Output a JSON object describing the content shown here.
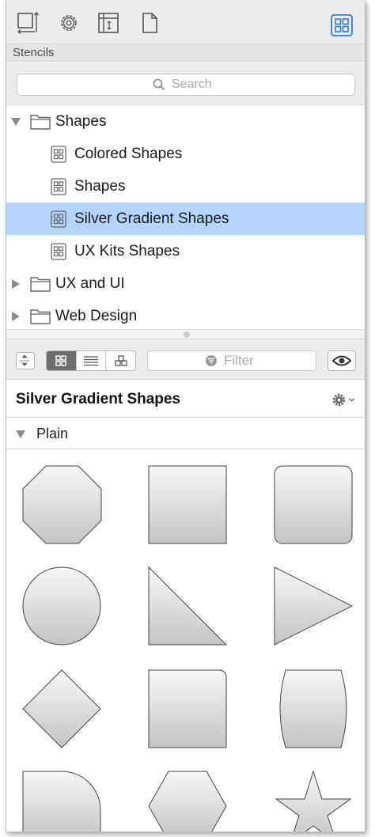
{
  "section_label": "Stencils",
  "search": {
    "placeholder": "Search"
  },
  "tree": {
    "items": [
      {
        "label": "Shapes",
        "type": "folder",
        "expanded": true
      },
      {
        "label": "Colored Shapes",
        "type": "stencil"
      },
      {
        "label": "Shapes",
        "type": "stencil"
      },
      {
        "label": "Silver Gradient Shapes",
        "type": "stencil",
        "selected": true
      },
      {
        "label": "UX Kits Shapes",
        "type": "stencil"
      },
      {
        "label": "UX and UI",
        "type": "folder",
        "expanded": false
      },
      {
        "label": "Web Design",
        "type": "folder",
        "expanded": false
      }
    ]
  },
  "filter": {
    "placeholder": "Filter"
  },
  "stencil": {
    "title": "Silver Gradient Shapes"
  },
  "group": {
    "label": "Plain"
  },
  "colors": {
    "selection": "#b4d5fb",
    "accent": "#2f7bd8",
    "shape_top": "#f7f7f7",
    "shape_bottom": "#c4c4c4"
  },
  "icons": [
    "canvas-size-icon",
    "gear-icon",
    "inspector-icon",
    "document-icon",
    "stencil-grid-icon",
    "search-icon",
    "filter-icon",
    "eye-icon"
  ]
}
